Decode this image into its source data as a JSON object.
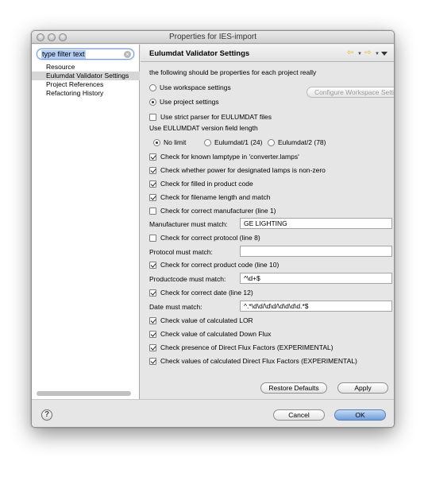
{
  "window": {
    "title": "Properties for IES-import"
  },
  "sidebar": {
    "filter_value": "type filter text",
    "items": [
      {
        "label": "Resource"
      },
      {
        "label": "Eulumdat Validator Settings"
      },
      {
        "label": "Project References"
      },
      {
        "label": "Refactoring History"
      }
    ]
  },
  "page": {
    "title": "Eulumdat Validator Settings",
    "description": "the following should be properties for each project really",
    "workspace_settings": "Use workspace settings",
    "project_settings": "Use project settings",
    "configure_button": "Configure Workspace Settings ...",
    "strict_parser": "Use strict parser for EULUMDAT files",
    "version_label": "Use EULUMDAT version field length",
    "version_options": [
      "No limit",
      "Eulumdat/1 (24)",
      "Eulumdat/2 (78)"
    ],
    "checks": {
      "lamptype": "Check for known lamptype in 'converter.lamps'",
      "power": "Check whether power for designated lamps is non-zero",
      "filled_code": "Check for filled in product code",
      "filename_length": "Check for filename length and match",
      "manufacturer": "Check for correct manufacturer (line 1)",
      "protocol": "Check for correct protocol (line 8)",
      "product_code": "Check for correct product code (line 10)",
      "date": "Check for correct date (line 12)",
      "lor": "Check value of calculated LOR",
      "down_flux": "Check value of calculated Down Flux",
      "direct_presence": "Check presence of Direct Flux Factors (EXPERIMENTAL)",
      "direct_values": "Check values of calculated Direct Flux Factors (EXPERIMENTAL)"
    },
    "fields": {
      "manufacturer_label": "Manufacturer must match:",
      "manufacturer_value": "GE LIGHTING",
      "protocol_label": "Protocol must match:",
      "protocol_value": "",
      "productcode_label": "Productcode must match:",
      "productcode_value": "^\\d+$",
      "date_label": "Date must match:",
      "date_value": "^.*\\d\\d/\\d\\d/\\d\\d\\d\\d.*$"
    },
    "restore_defaults": "Restore Defaults",
    "apply": "Apply"
  },
  "footer": {
    "help": "?",
    "cancel": "Cancel",
    "ok": "OK"
  }
}
